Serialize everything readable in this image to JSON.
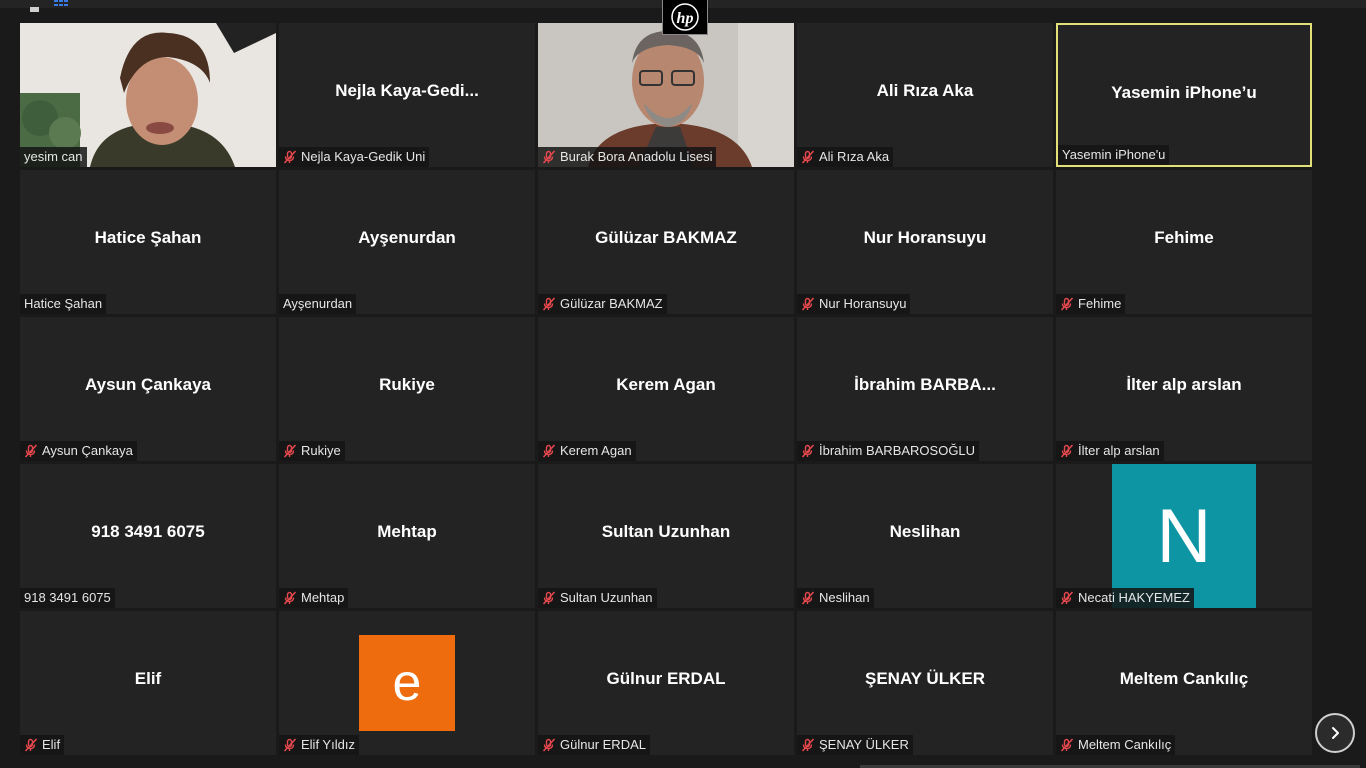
{
  "participants": [
    {
      "display": "",
      "label": "yesim can",
      "muted": false,
      "video": "person-woman"
    },
    {
      "display": "Nejla  Kaya-Gedi...",
      "label": "Nejla Kaya-Gedik Uni",
      "muted": true
    },
    {
      "display": "",
      "label": "Burak Bora Anadolu Lisesi",
      "muted": true,
      "video": "person-man"
    },
    {
      "display": "Ali Rıza Aka",
      "label": "Ali Rıza Aka",
      "muted": true
    },
    {
      "display": "Yasemin iPhone’u",
      "label": "Yasemin iPhone'u",
      "muted": false,
      "active": true
    },
    {
      "display": "Hatice Şahan",
      "label": "Hatice Şahan",
      "muted": false
    },
    {
      "display": "Ayşenurdan",
      "label": "Ayşenurdan",
      "muted": false
    },
    {
      "display": "Gülüzar BAKMAZ",
      "label": "Gülüzar BAKMAZ",
      "muted": true
    },
    {
      "display": "Nur Horansuyu",
      "label": "Nur Horansuyu",
      "muted": true
    },
    {
      "display": "Fehime",
      "label": "Fehime",
      "muted": true
    },
    {
      "display": "Aysun Çankaya",
      "label": "Aysun Çankaya",
      "muted": true
    },
    {
      "display": "Rukiye",
      "label": "Rukiye",
      "muted": true
    },
    {
      "display": "Kerem Agan",
      "label": "Kerem Agan",
      "muted": true
    },
    {
      "display": "İbrahim  BARBA...",
      "label": "İbrahim BARBAROSOĞLU",
      "muted": true
    },
    {
      "display": "İlter alp arslan",
      "label": "İlter alp arslan",
      "muted": true
    },
    {
      "display": "918 3491 6075",
      "label": "918 3491 6075",
      "muted": false
    },
    {
      "display": "Mehtap",
      "label": "Mehtap",
      "muted": true
    },
    {
      "display": "Sultan Uzunhan",
      "label": "Sultan Uzunhan",
      "muted": true
    },
    {
      "display": "Neslihan",
      "label": "Neslihan",
      "muted": true
    },
    {
      "display": "",
      "label": "Necati HAKYEMEZ",
      "muted": true,
      "avatar": {
        "letter": "N",
        "color": "#0e95a4",
        "size": "large"
      }
    },
    {
      "display": "Elif",
      "label": "Elif",
      "muted": true
    },
    {
      "display": "",
      "label": "Elif Yıldız",
      "muted": true,
      "avatar": {
        "letter": "e",
        "color": "#ef6c0e",
        "size": "small"
      }
    },
    {
      "display": "Gülnur ERDAL",
      "label": "Gülnur ERDAL",
      "muted": true
    },
    {
      "display": "ŞENAY ÜLKER",
      "label": "ŞENAY ÜLKER",
      "muted": true
    },
    {
      "display": "Meltem Cankılıç",
      "label": "Meltem Cankılıç",
      "muted": true
    }
  ],
  "logo": {
    "text": "hp"
  },
  "colors": {
    "active_border": "#e3e07a",
    "mute_red": "#e5484d"
  }
}
